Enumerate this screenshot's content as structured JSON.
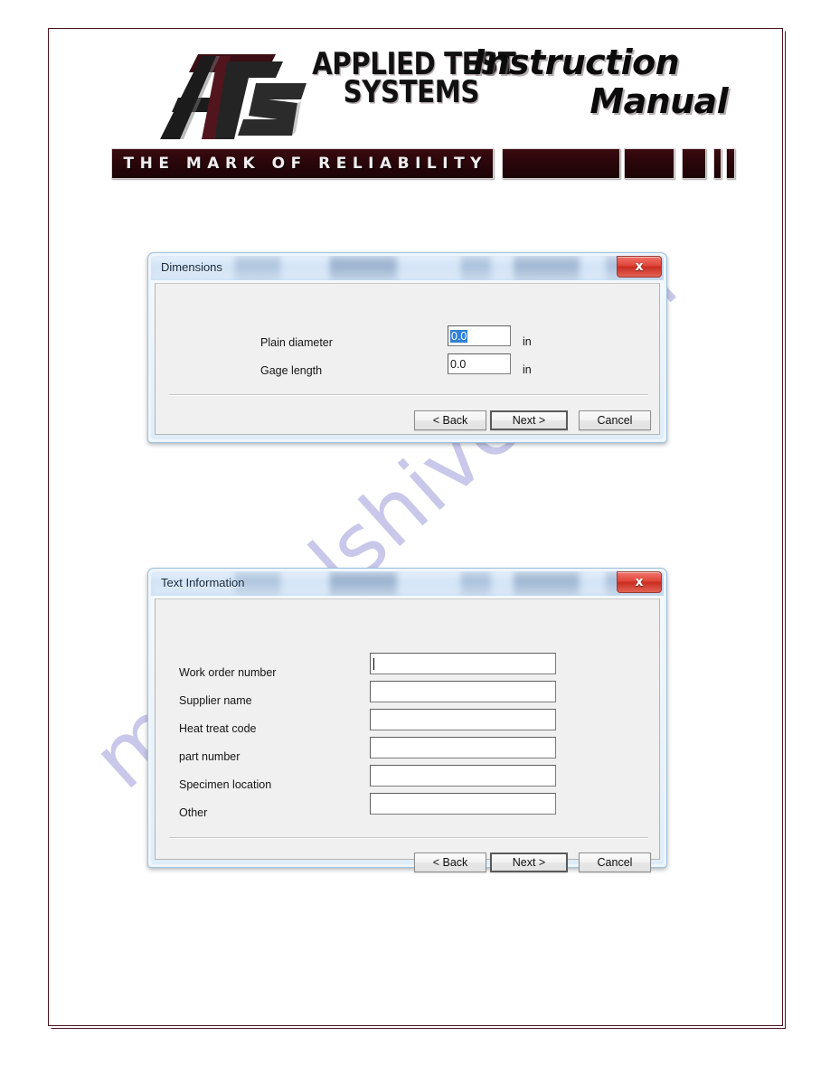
{
  "letterhead": {
    "logo_icon": "ats-logo-icon",
    "company_line1": "APPLIED TEST",
    "company_line2": "SYSTEMS",
    "manual_line1": "Instruction",
    "manual_line2": "Manual",
    "tagline": "THE MARK OF RELIABILITY",
    "bar_color": "#2a060a",
    "border_color": "#4a1520"
  },
  "watermark": {
    "text": "manualshive.com",
    "color": "#a9a7de"
  },
  "dialog_dimensions": {
    "title": "Dimensions",
    "close_label": "x",
    "fields": [
      {
        "label": "Plain diameter",
        "value": "0.0",
        "unit": "in",
        "selected": true
      },
      {
        "label": "Gage length",
        "value": "0.0",
        "unit": "in",
        "selected": false
      }
    ],
    "buttons": [
      {
        "label": "< Back",
        "focused": false
      },
      {
        "label": "Next >",
        "focused": true
      },
      {
        "label": "Cancel",
        "focused": false
      }
    ]
  },
  "dialog_textinfo": {
    "title": "Text Information",
    "close_label": "x",
    "fields": [
      {
        "label": "Work order number",
        "value": "",
        "caret": true
      },
      {
        "label": "Supplier name",
        "value": "",
        "caret": false
      },
      {
        "label": "Heat treat code",
        "value": "",
        "caret": false
      },
      {
        "label": "part number",
        "value": "",
        "caret": false
      },
      {
        "label": "Specimen location",
        "value": "",
        "caret": false
      },
      {
        "label": "Other",
        "value": "",
        "caret": false
      }
    ],
    "buttons": [
      {
        "label": "< Back",
        "focused": false
      },
      {
        "label": "Next >",
        "focused": true
      },
      {
        "label": "Cancel",
        "focused": false
      }
    ]
  }
}
